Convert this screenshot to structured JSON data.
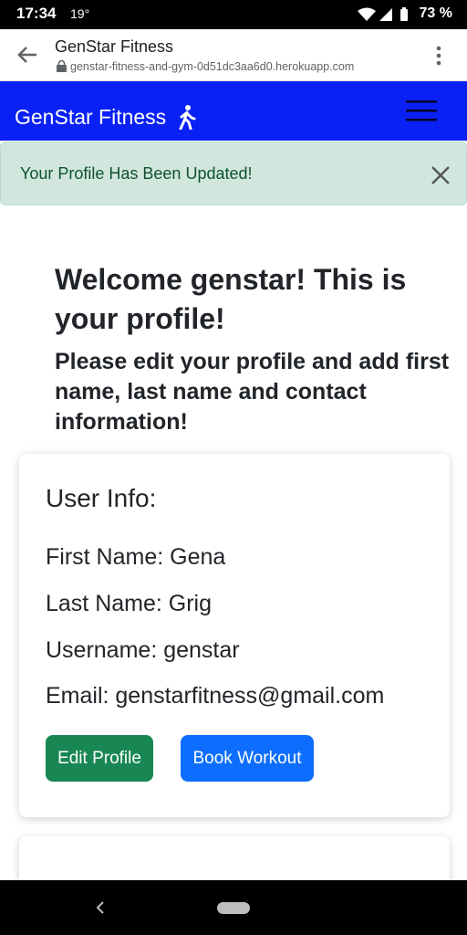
{
  "status_bar": {
    "time": "17:34",
    "temperature": "19°",
    "battery": "73 %"
  },
  "browser": {
    "title": "GenStar Fitness",
    "url": "genstar-fitness-and-gym-0d51dc3aa6d0.herokuapp.com"
  },
  "navbar": {
    "brand": "GenStar Fitness",
    "color": "#0a21f5"
  },
  "alert": {
    "message": "Your Profile Has Been Updated!",
    "color": "#d1e7dd"
  },
  "welcome": {
    "title": "Welcome genstar! This is your profile!",
    "subtitle": "Please edit your profile and add first name, last name and contact information!"
  },
  "user_info": {
    "heading": "User Info:",
    "first_name": "First Name: Gena",
    "last_name": "Last Name: Grig",
    "username": "Username: genstar",
    "email": "Email: genstarfitness@gmail.com"
  },
  "buttons": {
    "edit_profile": "Edit Profile",
    "book_workout": "Book Workout",
    "edit_color": "#198754",
    "book_color": "#0d6efd"
  }
}
